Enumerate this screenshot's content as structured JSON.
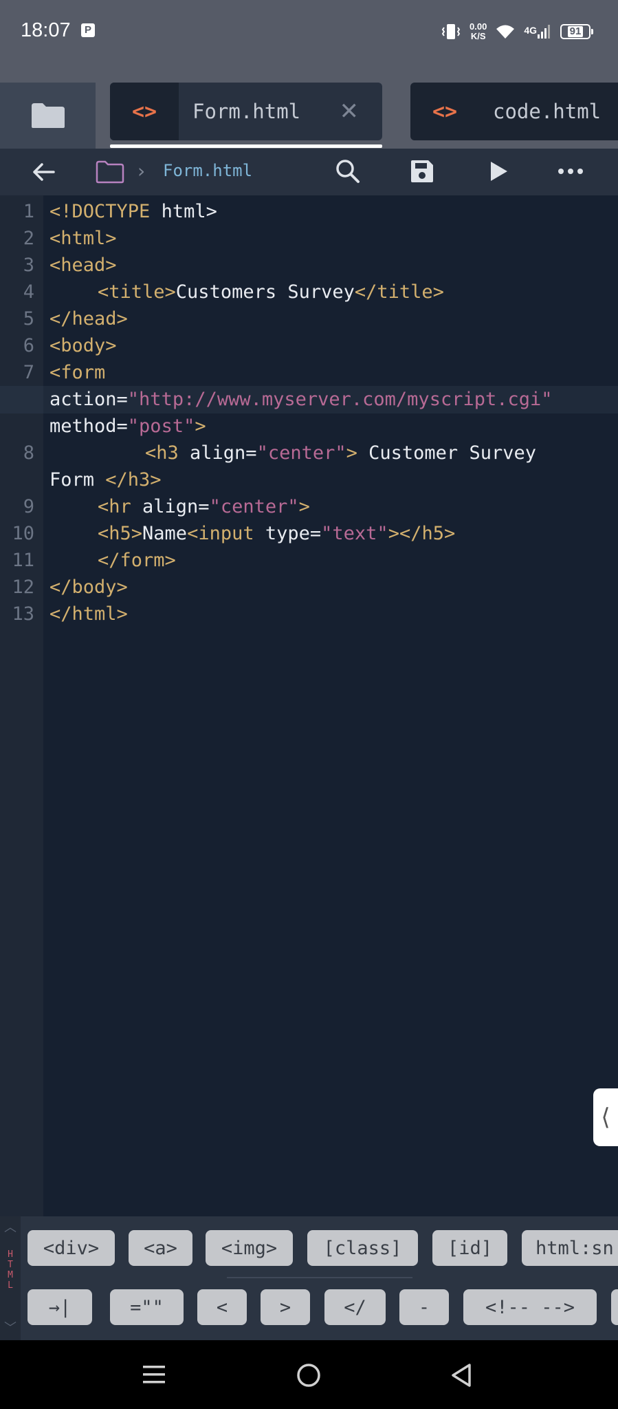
{
  "status_bar": {
    "time": "18:07",
    "p_badge": "P",
    "speed_value": "0.00",
    "speed_unit": "K/S",
    "network": "4G",
    "battery": "91"
  },
  "tabs": [
    {
      "label": "Form.html",
      "icon": "<>",
      "active": true
    },
    {
      "label": "code.html",
      "icon": "<>",
      "active": false
    }
  ],
  "toolbar": {
    "path": "Form.html",
    "icons": [
      "back-arrow-icon",
      "folder-icon",
      "search-icon",
      "save-icon",
      "run-icon",
      "more-icon"
    ]
  },
  "editor": {
    "line_numbers": [
      "1",
      "2",
      "3",
      "4",
      "5",
      "6",
      "7",
      "8",
      "9",
      "10",
      "11",
      "12",
      "13"
    ],
    "code": {
      "l1": "html>",
      "l1_tag": "<!DOCTYPE ",
      "l2": "<html>",
      "l3": "<head>",
      "l4_open": "<title>",
      "l4_text": "Customers Survey",
      "l4_close": "</title>",
      "l5": "</head>",
      "l6": "<body>",
      "l7": "<form",
      "l7b_attr": "action=",
      "l7b_val": "\"http://www.myserver.com/myscript.cgi\"",
      "l7c_attr": "method=",
      "l7c_val": "\"post\"",
      "l7c_end": ">",
      "l8_open": "<h3 ",
      "l8_attr": "align=",
      "l8_val": "\"center\"",
      "l8_end": ">",
      "l8_text": " Customer Survey",
      "l8b_text": "Form ",
      "l8b_close": "</h3>",
      "l9_open": "<hr ",
      "l9_attr": "align=",
      "l9_val": "\"center\"",
      "l9_end": ">",
      "l10_open": "<h5>",
      "l10_text": "Name",
      "l10_input": "<input ",
      "l10_attr": "type=",
      "l10_val": "\"text\"",
      "l10_end": "></h5>",
      "l11": "</form>",
      "l12": "</body>",
      "l13": "</html>"
    }
  },
  "snippets": {
    "side_label": [
      "H",
      "T",
      "M",
      "L"
    ],
    "row1": [
      "<div>",
      "<a>",
      "<img>",
      "[class]",
      "[id]",
      "html:sn"
    ],
    "row2": [
      "→|",
      "=\"\"",
      "<",
      ">",
      "</",
      "-",
      "<!-- -->"
    ]
  },
  "colors": {
    "tag": "#d3b06e",
    "string": "#b86a95",
    "text": "#e9ecf1",
    "editor_bg": "#162030",
    "accent_tab_icon": "#e8734a"
  }
}
